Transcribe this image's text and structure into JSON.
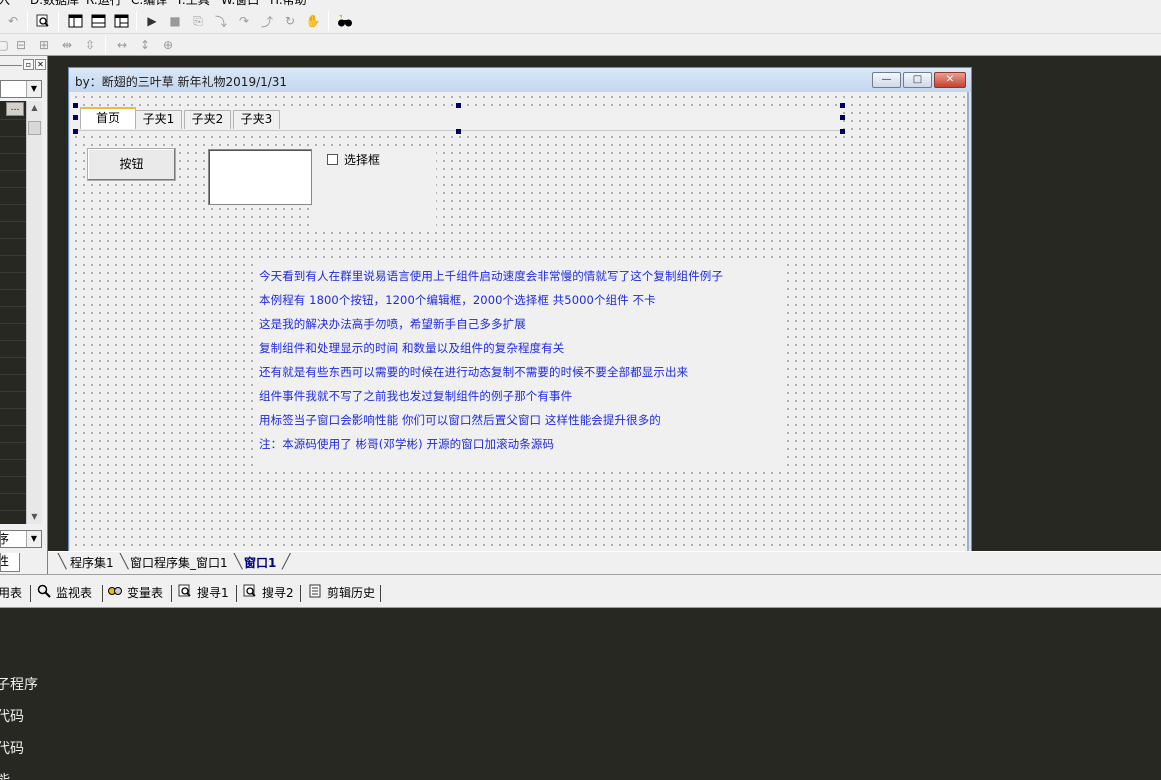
{
  "menubar": {
    "items": [
      "入",
      "D.数据库",
      "R.运行",
      "C.编译",
      "T.工具",
      "W.窗口",
      "H.帮助"
    ]
  },
  "toolbar": {
    "row1_icons": [
      "undo-icon",
      "find-icon",
      "window-layout-1-icon",
      "window-layout-2-icon",
      "window-layout-3-icon",
      "run-icon",
      "stop-icon",
      "step-icon",
      "step-into-icon",
      "step-over-icon",
      "step-out-icon",
      "run-to-cursor-icon",
      "hand-icon",
      "binoculars-icon"
    ],
    "row2_icons": [
      "align-left-icon",
      "align-center-icon",
      "align-right-icon",
      "distribute-h-icon",
      "distribute-v-icon",
      "same-width-icon",
      "same-height-icon",
      "same-size-icon"
    ]
  },
  "left_panel": {
    "combo_value": "",
    "header_button": "…",
    "bottom_combo_value": "序",
    "tab_label": "性"
  },
  "designer_window": {
    "title": "by：断翅的三叶草  新年礼物2019/1/31",
    "min_label": "—",
    "max_label": "□",
    "close_label": "✕",
    "tabs": [
      "首页",
      "子夹1",
      "子夹2",
      "子夹3"
    ],
    "active_tab": "首页",
    "button_label": "按钮",
    "edit_value": "",
    "checkbox_label": "选择框",
    "checkbox_checked": false,
    "label_lines": [
      "今天看到有人在群里说易语言使用上千组件启动速度会非常慢的情就写了这个复制组件例子",
      "本例程有  1800个按钮，1200个编辑框，2000个选择框  共5000个组件  不卡",
      "这是我的解决办法高手勿喷，希望新手自己多多扩展",
      "复制组件和处理显示的时间  和数量以及组件的复杂程度有关",
      "还有就是有些东西可以需要的时候在进行动态复制不需要的时候不要全部都显示出来",
      "组件事件我就不写了之前我也发过复制组件的例子那个有事件",
      "用标签当子窗口会影响性能  你们可以窗口然后置父窗口  这样性能会提升很多的",
      "注：本源码使用了  彬哥(邓学彬)  开源的窗口加滚动条源码"
    ],
    "label_color": "#1e2ae0"
  },
  "doc_tabs": [
    {
      "label": "程序集1",
      "active": false
    },
    {
      "label": "窗口程序集_窗口1",
      "active": false
    },
    {
      "label": "窗口1",
      "active": true
    }
  ],
  "bottom_tabs": [
    {
      "label": "用表",
      "icon": ""
    },
    {
      "label": "监视表",
      "icon": "search-icon"
    },
    {
      "label": "变量表",
      "icon": "variables-icon"
    },
    {
      "label": "搜寻1",
      "icon": "find-icon"
    },
    {
      "label": "搜寻2",
      "icon": "find-icon"
    },
    {
      "label": "剪辑历史",
      "icon": "clipboard-icon"
    }
  ],
  "output_lines": [
    "子程序",
    "代码",
    "代码",
    "能"
  ],
  "colors": {
    "workspace_bg": "#272822",
    "active_tab_accent": "#f5b83a",
    "selection_handle": "#000060"
  }
}
